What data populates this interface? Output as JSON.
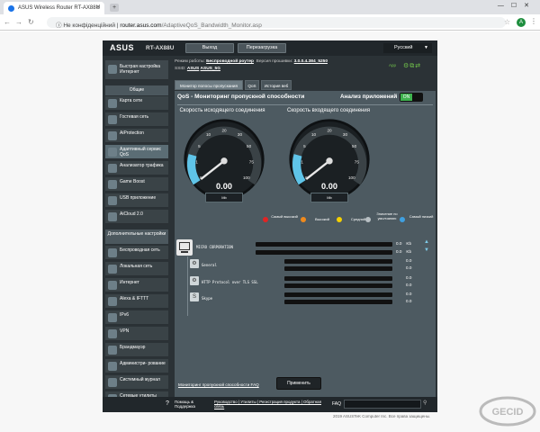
{
  "browser": {
    "tab_title": "ASUS Wireless Router RT-AX88U",
    "new_tab_icon": "plus-icon",
    "address_security": "Не конфіденційний",
    "address_host": "router.asus.com",
    "address_path": "/AdaptiveQoS_Bandwidth_Monitor.asp",
    "account_initial": "A"
  },
  "router": {
    "brand": "ASUS",
    "model": "RT-AX88U",
    "logout_label": "Выход",
    "reboot_label": "Перезагрузка",
    "language": "Русский"
  },
  "info": {
    "mode_label": "Режим работы:",
    "mode_value": "Беспроводной роутер",
    "firmware_label": "Версия прошивки:",
    "firmware_value": "3.0.0.4.384_5250",
    "ssid_label": "SSID:",
    "ssid_1": "ASUS",
    "ssid_2": "ASUS_5G",
    "app_label": "App"
  },
  "sidebar": {
    "quick_setup": "Быстрая настройка Интернет",
    "general_header": "Общие",
    "general_items": [
      {
        "label": "Карта сети",
        "icon": "network-map-icon"
      },
      {
        "label": "Гостевая сеть",
        "icon": "guest-network-icon"
      },
      {
        "label": "AiProtection",
        "icon": "shield-icon"
      },
      {
        "label": "Адаптивный сервис QoS",
        "icon": "qos-icon"
      },
      {
        "label": "Анализатор трафика",
        "icon": "traffic-analyzer-icon"
      },
      {
        "label": "Game Boost",
        "icon": "gamepad-icon"
      },
      {
        "label": "USB приложение",
        "icon": "usb-icon"
      },
      {
        "label": "AiCloud 2.0",
        "icon": "cloud-icon"
      }
    ],
    "advanced_header": "Дополнительные настройки",
    "advanced_items": [
      {
        "label": "Беспроводная сеть",
        "icon": "wireless-icon"
      },
      {
        "label": "Локальная сеть",
        "icon": "lan-icon"
      },
      {
        "label": "Интернет",
        "icon": "globe-icon"
      },
      {
        "label": "Alexa & IFTTT",
        "icon": "alexa-icon"
      },
      {
        "label": "IPv6",
        "icon": "ipv6-icon"
      },
      {
        "label": "VPN",
        "icon": "vpn-icon"
      },
      {
        "label": "Брандмауэр",
        "icon": "firewall-icon"
      },
      {
        "label": "Администри- рование",
        "icon": "admin-icon"
      },
      {
        "label": "Системный журнал",
        "icon": "log-icon"
      },
      {
        "label": "Сетевые утилиты",
        "icon": "tools-icon"
      }
    ]
  },
  "subtabs": [
    {
      "label": "Монитор полосы пропускания",
      "selected": true
    },
    {
      "label": "QoS",
      "selected": false
    },
    {
      "label": "История веб",
      "selected": false
    }
  ],
  "panel": {
    "title": "QoS - Мониторинг пропускной способности",
    "analyze_label": "Анализ приложений",
    "analyze_state": "ON",
    "upload_label": "Скорость исходящего соединения",
    "download_label": "Скорость входящего соединения",
    "upload_value": "0.00",
    "download_value": "0.00",
    "upload_badge": "Mb",
    "download_badge": "Mb",
    "gauge_ticks": [
      "0",
      "1",
      "5",
      "10",
      "20",
      "30",
      "50",
      "75",
      "100"
    ],
    "legend": [
      {
        "label": "Самый высокий",
        "color": "#e02424"
      },
      {
        "label": "Высокий",
        "color": "#f08a1c"
      },
      {
        "label": "Средний",
        "color": "#f5d000"
      },
      {
        "label": "Значение по умолчанию",
        "color": "#b8c0c4"
      },
      {
        "label": "Самый низкий",
        "color": "#3fa0e0"
      }
    ],
    "device_name": "MICRO CORPORATION",
    "device_rate_up": "0.0",
    "device_rate_down": "0.0",
    "rate_unit": "Kb",
    "apps": [
      {
        "name": "General",
        "rate_up": "0.0",
        "rate_down": "0.0",
        "icon": "app-general-icon"
      },
      {
        "name": "HTTP Protocol over TLS SSL",
        "rate_up": "0.0",
        "rate_down": "0.0",
        "icon": "app-https-icon"
      },
      {
        "name": "Skype",
        "rate_up": "0.0",
        "rate_down": "0.0",
        "icon": "skype-icon"
      }
    ],
    "faq_link": "Мониторинг пропускной способности FAQ",
    "apply_label": "Применить"
  },
  "footer": {
    "help": "Помощь & Поддержка",
    "links": "Руководство | Утилиты | Регистрация продукта | Обратная связь",
    "faq_label": "FAQ"
  },
  "copyright": "2019 ASUSTeK Computer Inc. Все права защищены.",
  "watermark_text": "GECID"
}
